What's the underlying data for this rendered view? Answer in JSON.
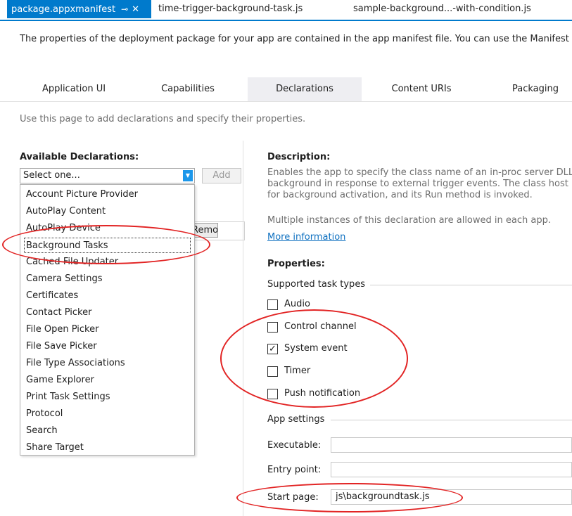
{
  "doc_tabs": {
    "active": "package.appxmanifest",
    "tab2": "time-trigger-background-task.js",
    "tab3": "sample-background...-with-condition.js"
  },
  "intro": "The properties of the deployment package for your app are contained in the app manifest file. You can use the Manifest",
  "manifest_tabs": [
    "Application UI",
    "Capabilities",
    "Declarations",
    "Content URIs",
    "Packaging"
  ],
  "hint": "Use this page to add declarations and specify their properties.",
  "available": {
    "title": "Available Declarations:",
    "select_value": "Select one...",
    "add_label": "Add",
    "remove_label": "Remove",
    "items": [
      "Account Picture Provider",
      "AutoPlay Content",
      "AutoPlay Device",
      "Background Tasks",
      "Cached File Updater",
      "Camera Settings",
      "Certificates",
      "Contact Picker",
      "File Open Picker",
      "File Save Picker",
      "File Type Associations",
      "Game Explorer",
      "Print Task Settings",
      "Protocol",
      "Search",
      "Share Target"
    ]
  },
  "description": {
    "title": "Description:",
    "line1": "Enables the app to specify the class name of an in-proc server DLL",
    "line2": "background in response to external trigger events. The class host",
    "line3": "for background activation, and its Run method is invoked.",
    "line4": "Multiple instances of this declaration are allowed in each app.",
    "more_info": "More information"
  },
  "properties": {
    "title": "Properties:",
    "task_types_label": "Supported task types",
    "task_types": [
      {
        "label": "Audio",
        "checked": false
      },
      {
        "label": "Control channel",
        "checked": false
      },
      {
        "label": "System event",
        "checked": true
      },
      {
        "label": "Timer",
        "checked": false
      },
      {
        "label": "Push notification",
        "checked": false
      }
    ],
    "app_settings_label": "App settings",
    "executable_label": "Executable:",
    "executable_value": "",
    "entry_point_label": "Entry point:",
    "entry_point_value": "",
    "start_page_label": "Start page:",
    "start_page_value": "js\\backgroundtask.js"
  },
  "colors": {
    "accent": "#007acc",
    "annotation": "#e22424",
    "link": "#0e70c0"
  }
}
